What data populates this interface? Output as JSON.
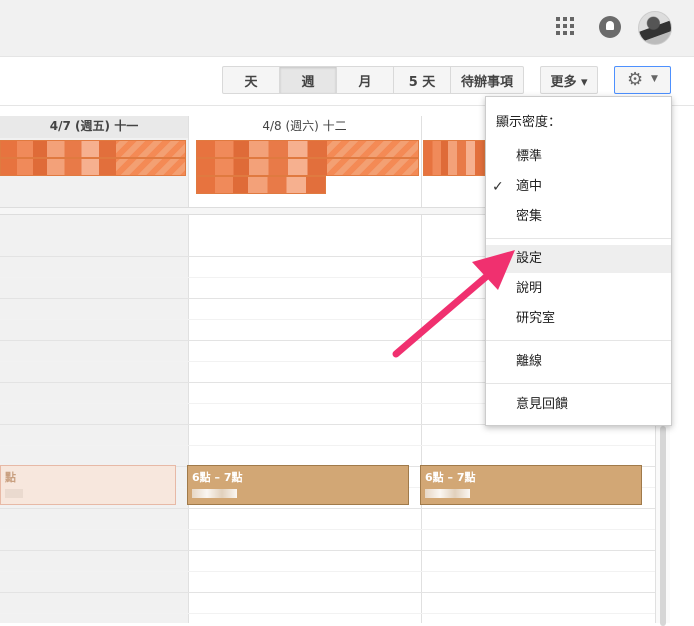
{
  "topbar": {
    "apps_icon": "apps-grid-icon",
    "notifications_icon": "bell-icon",
    "avatar": "user-avatar"
  },
  "view_buttons": [
    {
      "label": "天"
    },
    {
      "label": "週"
    },
    {
      "label": "月"
    },
    {
      "label": "5 天"
    },
    {
      "label": "待辦事項"
    }
  ],
  "more_label": "更多 ▾",
  "settings_icon": "gear-icon",
  "day_headers": [
    "4/7 (週五) 十一",
    "4/8 (週六) 十二"
  ],
  "events": [
    {
      "time": "點"
    },
    {
      "time": "6點 – 7點"
    },
    {
      "time": "6點 – 7點"
    }
  ],
  "menu": {
    "density_header": "顯示密度：",
    "items": [
      "標準",
      "適中",
      "密集"
    ],
    "checked": "✓",
    "settings": "設定",
    "help": "說明",
    "labs": "研究室",
    "offline": "離線",
    "feedback": "意見回饋"
  },
  "colors": {
    "accent": "#4d90fe",
    "event_orange": "#f48a55",
    "event_tan": "#d2a775",
    "arrow": "#f0306f"
  }
}
